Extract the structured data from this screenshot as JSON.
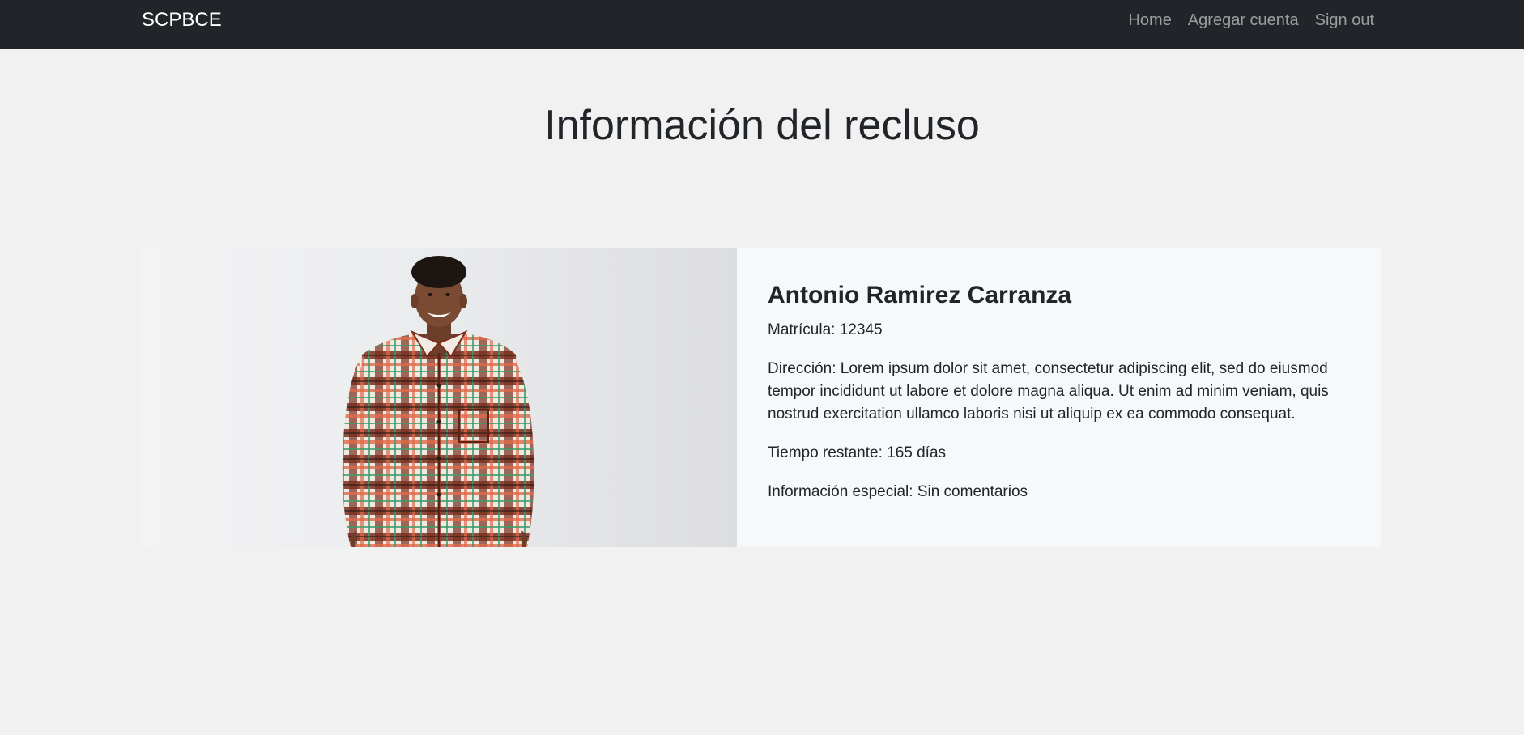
{
  "navbar": {
    "brand": "SCPBCE",
    "links": [
      {
        "label": "Home"
      },
      {
        "label": "Agregar cuenta"
      },
      {
        "label": "Sign out"
      }
    ]
  },
  "page": {
    "title": "Información del recluso"
  },
  "inmate": {
    "name": "Antonio Ramirez Carranza",
    "matricula": "Matrícula: 12345",
    "direccion": "Dirección: Lorem ipsum dolor sit amet, consectetur adipiscing elit, sed do eiusmod tempor incididunt ut labore et dolore magna aliqua. Ut enim ad minim veniam, quis nostrud exercitation ullamco laboris nisi ut aliquip ex ea commodo consequat.",
    "tiempo": "Tiempo restante: 165 días",
    "info_especial": "Información especial: Sin comentarios"
  },
  "colors": {
    "navbar_bg": "#212529",
    "page_bg": "#f1f1f1",
    "card_bg": "#f7f8fc",
    "text": "#212529"
  }
}
